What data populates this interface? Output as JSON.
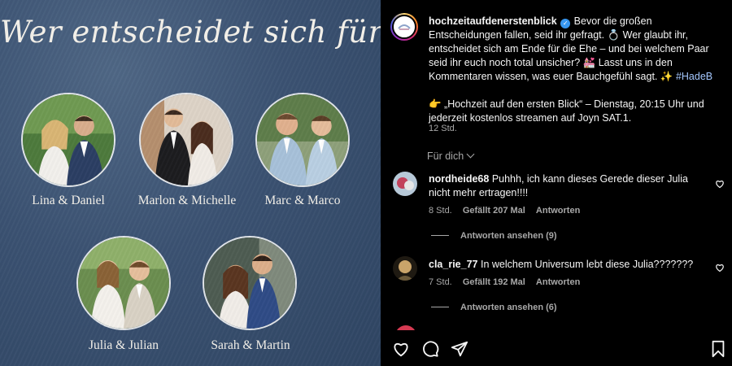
{
  "post_image": {
    "headline": "Wer entscheidet sich für die Ehe?",
    "couples": [
      {
        "name": "Lina & Daniel"
      },
      {
        "name": "Marlon & Michelle"
      },
      {
        "name": "Marc & Marco"
      },
      {
        "name": "Julia & Julian"
      },
      {
        "name": "Sarah & Martin"
      }
    ]
  },
  "caption": {
    "username": "hochzeitaufdenerstenblick",
    "text_1": "Bevor die großen Entscheidungen fallen, seid ihr gefragt. 💍 Wer glaubt ihr, entscheidet sich am Ende für die Ehe – und bei welchem Paar seid ihr euch noch total unsicher? 💒 Lasst uns in den Kommentaren wissen, was euer Bauchgefühl sagt. ✨",
    "hashtag": "#HadeB",
    "text_2": "👉 „Hochzeit auf den ersten Blick“ – Dienstag, 20:15 Uhr und jederzeit kostenlos streamen auf Joyn SAT.1.",
    "time": "12 Std."
  },
  "for_you": "Für dich",
  "comments": [
    {
      "username": "nordheide68",
      "text": "Puhhh, ich kann dieses Gerede dieser Julia nicht mehr ertragen!!!!",
      "time": "8 Std.",
      "likes": "Gefällt 207 Mal",
      "reply": "Antworten",
      "view_replies": "Antworten ansehen (9)"
    },
    {
      "username": "cla_rie_77",
      "text": "In welchem Universum lebt diese Julia???????",
      "time": "7 Std.",
      "likes": "Gefällt 192 Mal",
      "reply": "Antworten",
      "view_replies": "Antworten ansehen (6)"
    }
  ],
  "icons": [
    "heart-icon",
    "comment-icon",
    "share-icon",
    "bookmark-icon",
    "verified-icon"
  ],
  "colors": {
    "panel_bg": "#000000",
    "image_bg": "#3b5272",
    "link": "#a5c8ff",
    "muted": "#a8a8a8"
  }
}
